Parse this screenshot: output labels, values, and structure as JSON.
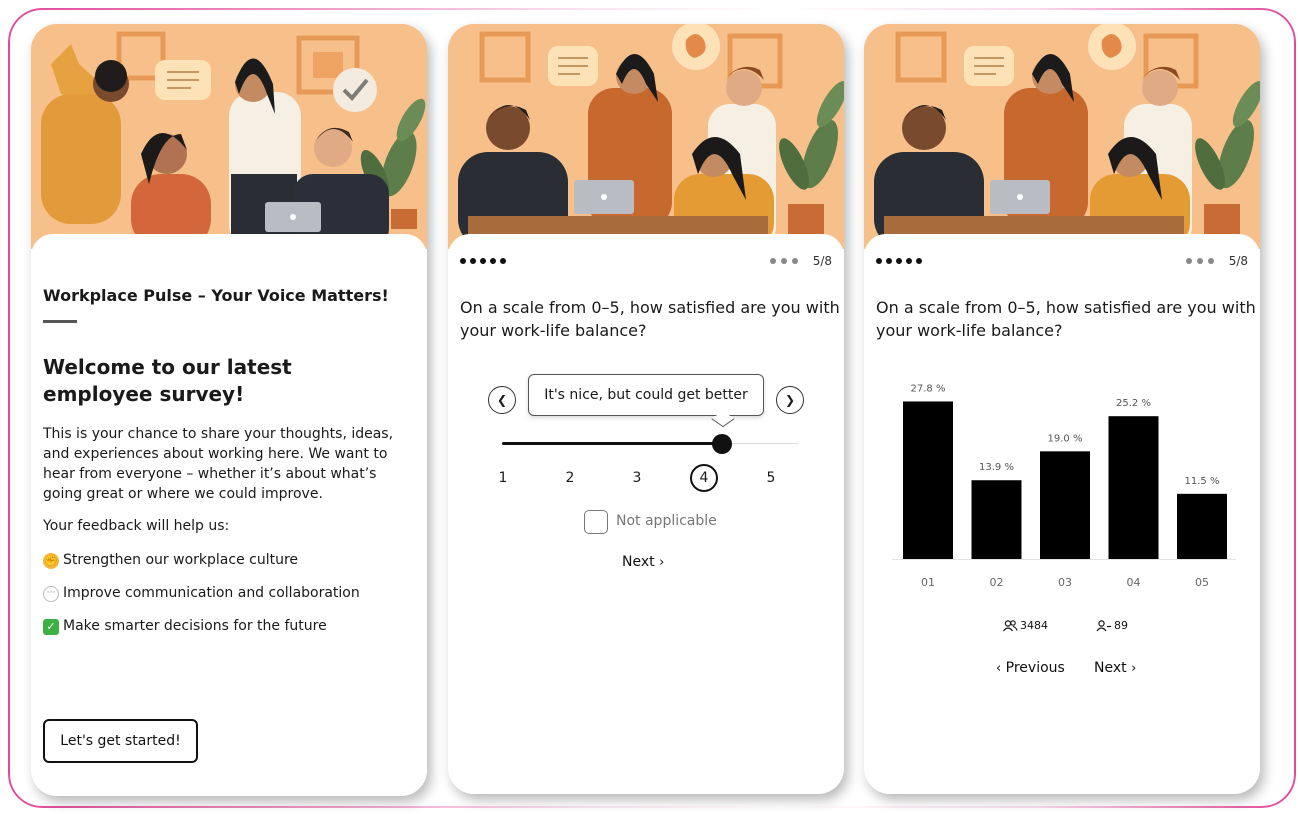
{
  "intro": {
    "title": "Workplace Pulse – Your Voice Matters!",
    "heading": "Welcome to our latest employee survey!",
    "paragraph": "This is your chance to share your thoughts, ideas, and experiences about working here. We want to hear from everyone – whether it’s about what’s going great or where we could improve.",
    "help_label": "Your feedback will help us:",
    "benefits": [
      {
        "icon": "flexed-biceps-icon",
        "text": "Strengthen our workplace culture"
      },
      {
        "icon": "speech-balloon-icon",
        "text": "Improve communication and collaboration"
      },
      {
        "icon": "check-mark-icon",
        "text": "Make smarter decisions for the future"
      }
    ],
    "start_button": "Let's get started!"
  },
  "question_card": {
    "page_count": "5/8",
    "question": "On a scale from 0–5, how satisfied are you with your work-life balance?",
    "tooltip": "It's nice, but could get better",
    "scale": [
      "1",
      "2",
      "3",
      "4",
      "5"
    ],
    "selected_value": 4,
    "not_applicable_label": "Not applicable",
    "not_applicable_checked": false,
    "next_label": "Next"
  },
  "results_card": {
    "page_count": "5/8",
    "question": "On a scale from 0–5, how satisfied are you with your work-life balance?",
    "participants": "3484",
    "respondents": "89",
    "previous_label": "Previous",
    "next_label": "Next"
  },
  "chart_data": {
    "type": "bar",
    "categories": [
      "01",
      "02",
      "03",
      "04",
      "05"
    ],
    "values": [
      27.8,
      13.9,
      19.0,
      25.2,
      11.5
    ],
    "value_labels": [
      "27.8 %",
      "13.9 %",
      "19.0 %",
      "25.2 %",
      "11.5 %"
    ],
    "ylim": [
      0,
      30
    ],
    "grid": false,
    "bar_color": "#000000"
  },
  "colors": {
    "hero_background": "#f7c08a",
    "accent_border": "#e2479b"
  }
}
